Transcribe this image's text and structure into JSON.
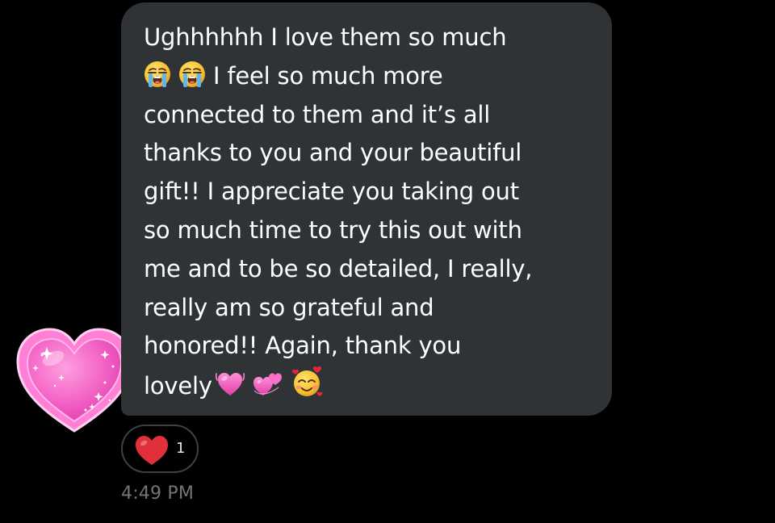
{
  "message": {
    "lines": [
      "Ughhhhhh I love them so much",
      "I feel so much more",
      "connected to them and it’s all",
      "thanks to you and your beautiful",
      "gift!! I appreciate you taking out",
      "so much time to try this out with",
      "me and to be so detailed, I really,",
      "really am so grateful and",
      "honored!! Again, thank you",
      "lovely"
    ],
    "emojis_line2": [
      "loudly-crying-face-emoji",
      "loudly-crying-face-emoji"
    ],
    "emojis_line10": [
      "beating-heart-emoji",
      "revolving-hearts-emoji",
      "smiling-face-with-hearts-emoji"
    ],
    "bubble_color": "#2f3336",
    "text_color": "#ffffff"
  },
  "sticker": {
    "icon": "sparkling-pink-heart-sticker"
  },
  "reaction": {
    "icon": "red-heart-icon",
    "count": "1"
  },
  "timestamp": "4:49 PM",
  "colors": {
    "background": "#000000",
    "timestamp": "#71767b",
    "reaction_heart": "#e0303c",
    "sticker_pink": "#f25fc4"
  }
}
